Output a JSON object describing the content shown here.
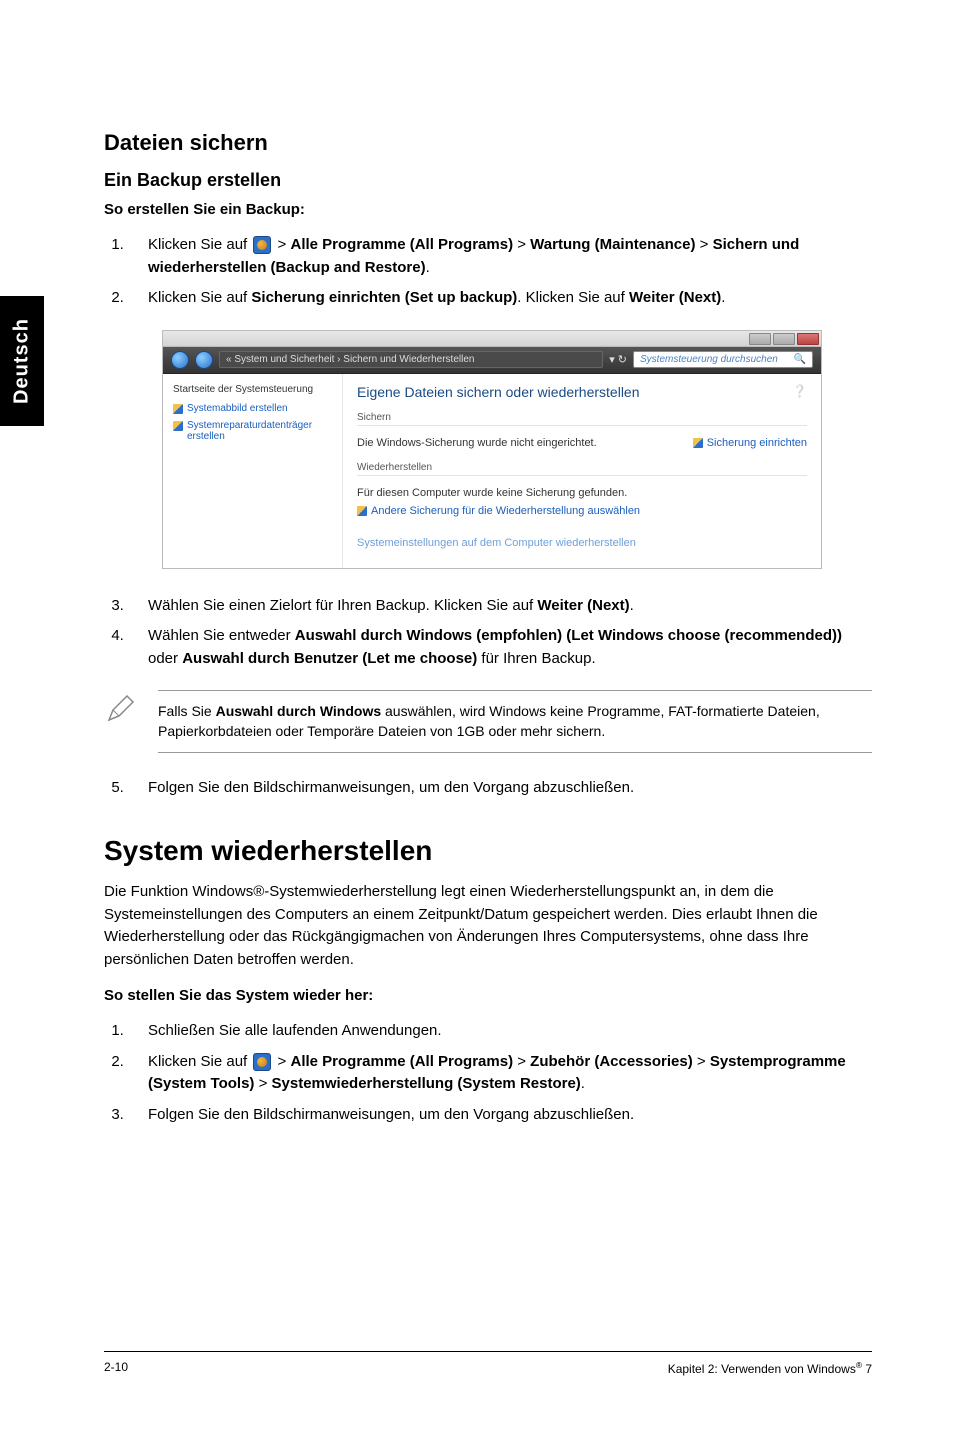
{
  "sideTab": "Deutsch",
  "h_backup": "Dateien sichern",
  "h_createBackup": "Ein Backup erstellen",
  "instr_createBackup": "So erstellen Sie ein Backup:",
  "step1_prefix": "Klicken Sie auf ",
  "path_allPrograms": "Alle Programme (All Programs)",
  "path_maintenance": "Wartung (Maintenance)",
  "path_backupRestore": "Sichern und wiederherstellen (Backup and Restore)",
  "step2_a": "Klicken Sie auf ",
  "step2_b": "Sicherung einrichten (Set up backup)",
  "step2_c": ". Klicken Sie auf ",
  "step2_d": "Weiter (Next)",
  "step2_e": ".",
  "shot": {
    "crumb": "« System und Sicherheit  ›  Sichern und Wiederherstellen",
    "search": "Systemsteuerung durchsuchen",
    "side_head": "Startseite der Systemsteuerung",
    "side_link1": "Systemabbild erstellen",
    "side_link2": "Systemreparaturdatenträger erstellen",
    "main_title": "Eigene Dateien sichern oder wiederherstellen",
    "grp_sichern": "Sichern",
    "row_not_configured": "Die Windows-Sicherung wurde nicht eingerichtet.",
    "link_setup": "Sicherung einrichten",
    "grp_restore": "Wiederherstellen",
    "row_nobackup": "Für diesen Computer wurde keine Sicherung gefunden.",
    "link_other": "Andere Sicherung für die Wiederherstellung auswählen",
    "link_sysrestore": "Systemeinstellungen auf dem Computer wiederherstellen"
  },
  "step3_a": "Wählen Sie einen Zielort für Ihren Backup. Klicken Sie auf ",
  "step3_b": "Weiter (Next)",
  "step3_c": ".",
  "step4_a": "Wählen Sie entweder ",
  "step4_b": "Auswahl durch Windows (empfohlen) (Let Windows choose (recommended))",
  "step4_c": " oder ",
  "step4_d": "Auswahl durch Benutzer (Let me choose)",
  "step4_e": " für Ihren Backup.",
  "note_a": "Falls Sie ",
  "note_b": "Auswahl durch Windows",
  "note_c": " auswählen, wird Windows keine Programme, FAT-formatierte Dateien, Papierkorbdateien oder Temporäre Dateien von 1GB oder mehr sichern.",
  "step5": "Folgen Sie den Bildschirmanweisungen, um den Vorgang abzuschließen.",
  "h_sysrestore": "System wiederherstellen",
  "para_restore": "Die Funktion Windows®-Systemwiederherstellung legt einen Wiederherstellungspunkt an, in dem die Systemeinstellungen des Computers an einem Zeitpunkt/Datum gespeichert werden. Dies erlaubt Ihnen die Wiederherstellung oder das Rückgängigmachen von Änderungen Ihres Computersystems, ohne dass Ihre persönlichen Daten betroffen werden.",
  "instr_restore": "So stellen Sie das System wieder her:",
  "r_step1": "Schließen Sie alle laufenden Anwendungen.",
  "r_step2_prefix": "Klicken Sie auf ",
  "path_accessories": "Zubehör (Accessories)",
  "path_systools": "Systemprogramme (System Tools)",
  "path_sysrestore": "Systemwiederherstellung (System Restore)",
  "r_step3": "Folgen Sie den Bildschirmanweisungen, um den Vorgang abzuschließen.",
  "footer_left": "2-10",
  "footer_right_a": "Kapitel 2: Verwenden von Windows",
  "footer_right_b": " 7"
}
